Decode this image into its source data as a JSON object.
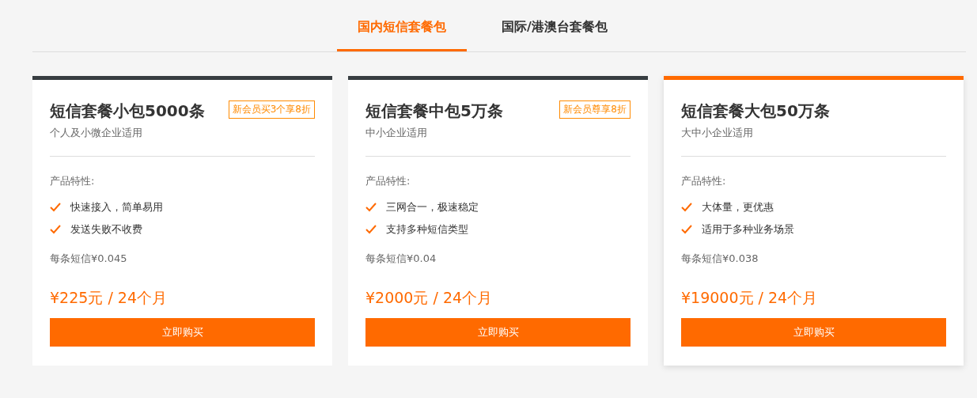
{
  "tabs": [
    {
      "label": "国内短信套餐包",
      "selected": true
    },
    {
      "label": "国际/港澳台套餐包",
      "selected": false
    }
  ],
  "plans": [
    {
      "title": "短信套餐小包5000条",
      "badge": "新会员买3个享8折",
      "subtitle": "个人及小微企业适用",
      "features_label": "产品特性:",
      "features": [
        "快速接入，简单易用",
        "发送失败不收费"
      ],
      "unit_price": "每条短信¥0.045",
      "price": "¥225元 / 24个月",
      "button": "立即购买",
      "selected": false
    },
    {
      "title": "短信套餐中包5万条",
      "badge": "新会员尊享8折",
      "subtitle": "中小企业适用",
      "features_label": "产品特性:",
      "features": [
        "三网合一，极速稳定",
        "支持多种短信类型"
      ],
      "unit_price": "每条短信¥0.04",
      "price": "¥2000元 / 24个月",
      "button": "立即购买",
      "selected": false
    },
    {
      "title": "短信套餐大包50万条",
      "subtitle": "大中小企业适用",
      "features_label": "产品特性:",
      "features": [
        "大体量，更优惠",
        "适用于多种业务场景"
      ],
      "unit_price": "每条短信¥0.038",
      "price": "¥19000元 / 24个月",
      "button": "立即购买",
      "selected": true
    }
  ]
}
